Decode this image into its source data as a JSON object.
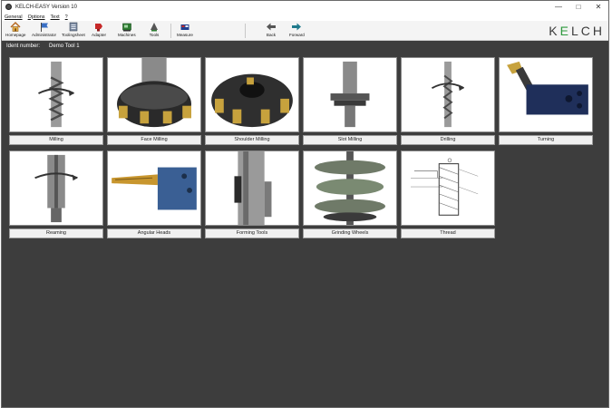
{
  "window": {
    "title": "KELCH-EASY Version 10"
  },
  "menu": [
    {
      "label": "General"
    },
    {
      "label": "Options"
    },
    {
      "label": "Text"
    },
    {
      "label": "?"
    }
  ],
  "toolbar": {
    "homepage": "Homepage",
    "administrator": "Administrator",
    "toolingsheet": "Toolingsheet",
    "adapter": "Adapter",
    "machines": "Machines",
    "tools": "Tools",
    "measure": "Measure",
    "back": "Back",
    "forward": "Forward"
  },
  "logo": {
    "prefix": "K",
    "accent": "E",
    "suffix": "LCH"
  },
  "ident": {
    "label": "Ident number:",
    "value": "Demo Tool 1"
  },
  "tiles": [
    {
      "label": "Milling",
      "icon": "milling-tool-icon"
    },
    {
      "label": "Face Milling",
      "icon": "face-mill-icon"
    },
    {
      "label": "Shoulder Milling",
      "icon": "shoulder-mill-icon"
    },
    {
      "label": "Slot Milling",
      "icon": "slot-mill-icon"
    },
    {
      "label": "Drilling",
      "icon": "drill-icon"
    },
    {
      "label": "Turning",
      "icon": "turning-tool-icon"
    },
    {
      "label": "Reaming",
      "icon": "reamer-icon"
    },
    {
      "label": "Angular Heads",
      "icon": "angular-head-icon"
    },
    {
      "label": "Forming Tools",
      "icon": "forming-tool-icon"
    },
    {
      "label": "Grinding Wheels",
      "icon": "grinding-wheel-icon"
    },
    {
      "label": "Thread",
      "icon": "thread-drawing-icon"
    }
  ],
  "colors": {
    "workspace": "#3d3d3d",
    "logo_accent": "#2e9a3e"
  }
}
